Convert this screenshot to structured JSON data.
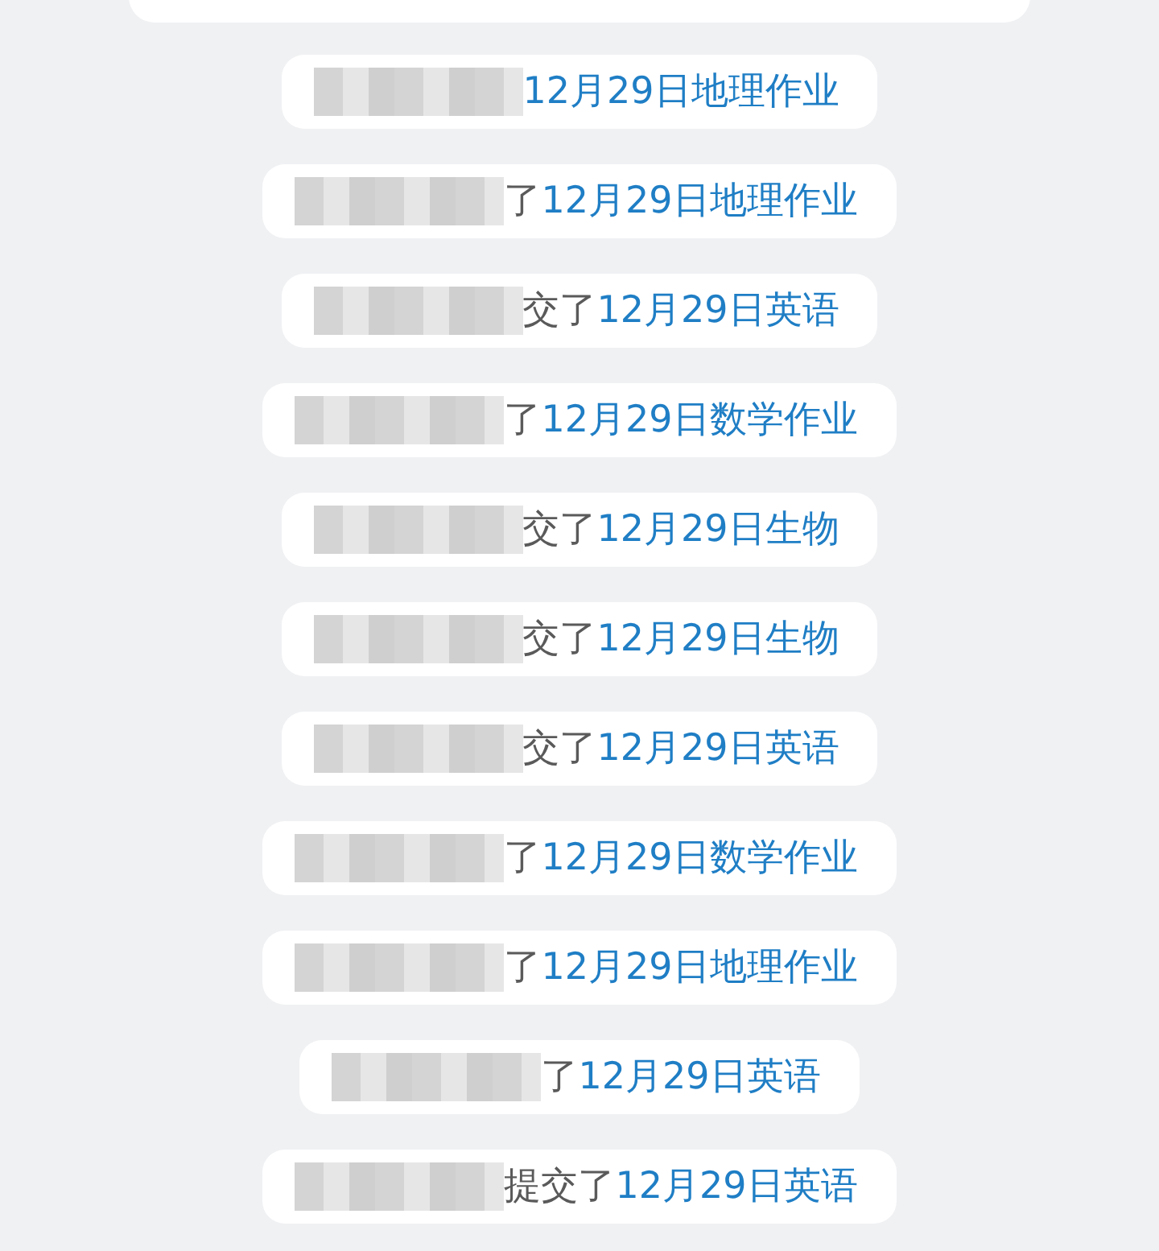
{
  "notices": [
    {
      "link": "12月29日地理作业"
    },
    {
      "prefix": "了",
      "link": "12月29日地理作业"
    },
    {
      "prefix": "交了",
      "link": "12月29日英语"
    },
    {
      "prefix": "了",
      "link": "12月29日数学作业"
    },
    {
      "prefix": "交了",
      "link": "12月29日生物"
    },
    {
      "prefix": "交了",
      "link": "12月29日生物"
    },
    {
      "prefix": "交了",
      "link": "12月29日英语"
    },
    {
      "prefix": "了",
      "link": "12月29日数学作业"
    },
    {
      "prefix": "了",
      "link": "12月29日地理作业"
    },
    {
      "prefix": "了",
      "link": "12月29日英语"
    },
    {
      "prefix": "提交了",
      "link": "12月29日英语"
    }
  ]
}
